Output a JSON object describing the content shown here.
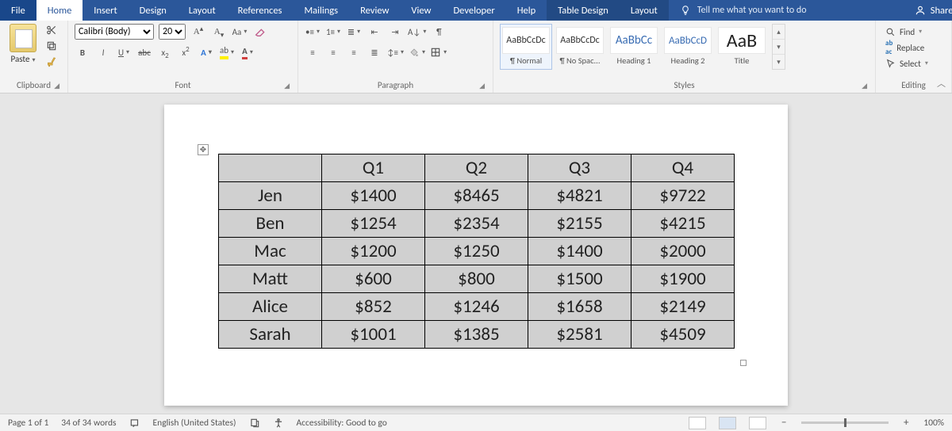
{
  "tabs": [
    "File",
    "Home",
    "Insert",
    "Design",
    "Layout",
    "References",
    "Mailings",
    "Review",
    "View",
    "Developer",
    "Help"
  ],
  "active_tab": "Home",
  "context_tabs": [
    "Table Design",
    "Layout"
  ],
  "tell_me_placeholder": "Tell me what you want to do",
  "share_label": "Share",
  "clipboard": {
    "paste": "Paste",
    "title": "Clipboard"
  },
  "font": {
    "name": "Calibri (Body)",
    "size": "20",
    "title": "Font"
  },
  "paragraph": {
    "title": "Paragraph"
  },
  "styles": {
    "title": "Styles",
    "items": [
      {
        "preview": "AaBbCcDc",
        "label": "¶ Normal",
        "size": "12px",
        "color": "#333"
      },
      {
        "preview": "AaBbCcDc",
        "label": "¶ No Spac...",
        "size": "12px",
        "color": "#333"
      },
      {
        "preview": "AaBbCc",
        "label": "Heading 1",
        "size": "15px",
        "color": "#3a6db3"
      },
      {
        "preview": "AaBbCcD",
        "label": "Heading 2",
        "size": "13px",
        "color": "#3a6db3"
      },
      {
        "preview": "AaB",
        "label": "Title",
        "size": "24px",
        "color": "#222"
      }
    ]
  },
  "editing": {
    "find": "Find",
    "replace": "Replace",
    "select": "Select",
    "title": "Editing"
  },
  "chart_data": {
    "type": "table",
    "columns": [
      "",
      "Q1",
      "Q2",
      "Q3",
      "Q4"
    ],
    "rows": [
      [
        "Jen",
        "$1400",
        "$8465",
        "$4821",
        "$9722"
      ],
      [
        "Ben",
        "$1254",
        "$2354",
        "$2155",
        "$4215"
      ],
      [
        "Mac",
        "$1200",
        "$1250",
        "$1400",
        "$2000"
      ],
      [
        "Matt",
        "$600",
        "$800",
        "$1500",
        "$1900"
      ],
      [
        "Alice",
        "$852",
        "$1246",
        "$1658",
        "$2149"
      ],
      [
        "Sarah",
        "$1001",
        "$1385",
        "$2581",
        "$4509"
      ]
    ]
  },
  "status": {
    "page": "Page 1 of 1",
    "words": "34 of 34 words",
    "lang": "English (United States)",
    "a11y": "Accessibility: Good to go",
    "zoom": "100%"
  }
}
